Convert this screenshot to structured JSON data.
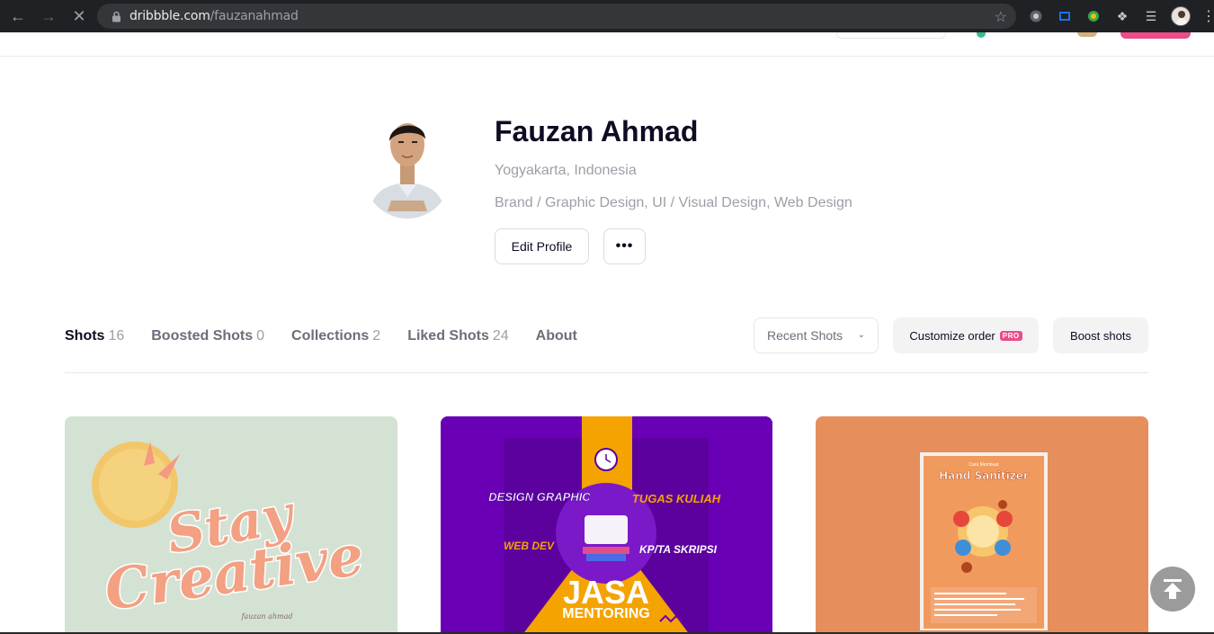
{
  "browser": {
    "url_domain": "dribbble.com",
    "url_path": "/fauzanahmad"
  },
  "profile": {
    "name": "Fauzan Ahmad",
    "location": "Yogyakarta, Indonesia",
    "skills": "Brand / Graphic Design, UI / Visual Design, Web Design",
    "edit_label": "Edit Profile",
    "more_label": "•••"
  },
  "tabs": [
    {
      "label": "Shots",
      "count": "16"
    },
    {
      "label": "Boosted Shots",
      "count": "0"
    },
    {
      "label": "Collections",
      "count": "2"
    },
    {
      "label": "Liked Shots",
      "count": "24"
    },
    {
      "label": "About",
      "count": ""
    }
  ],
  "toolbar": {
    "sort_value": "Recent Shots",
    "customize_label": "Customize order",
    "pro_badge": "PRO",
    "boost_label": "Boost shots"
  },
  "shots": [
    {
      "line1": "Stay",
      "line2": "Creative",
      "signature": "fauzan ahmad"
    },
    {
      "top_left": "DESIGN GRAPHIC",
      "top_right": "TUGAS KULIAH",
      "mid_left": "WEB DEV",
      "mid_right": "KP/TA SKRIPSI",
      "title": "JASA",
      "subtitle": "MENTORING"
    },
    {
      "heading_small": "Cara Membuat",
      "heading": "Hand Sanitizer"
    }
  ],
  "colors": {
    "brand_pink": "#ea4c89",
    "text_dark": "#0d0c22",
    "text_muted": "#9e9ea7",
    "shot1_bg": "#d4e2d4",
    "shot2_bg": "#6a00b6",
    "shot3_bg": "#e68f5c"
  }
}
